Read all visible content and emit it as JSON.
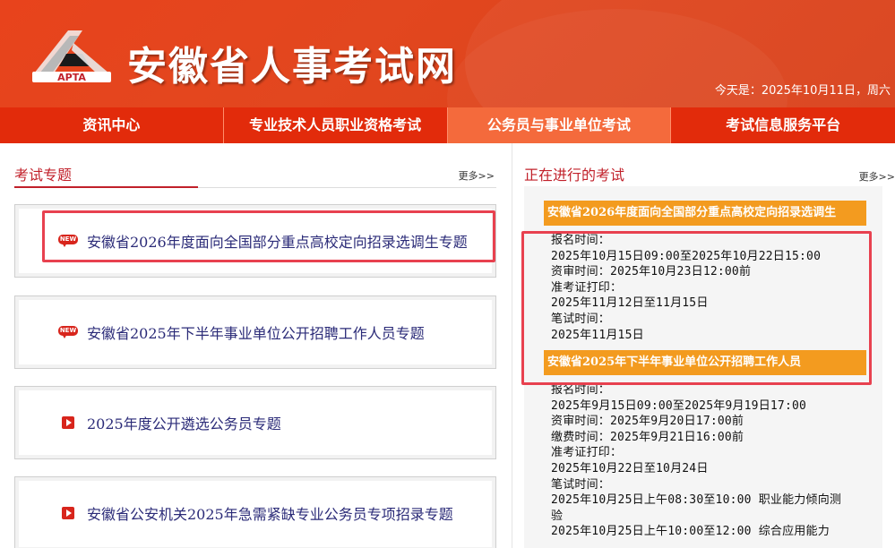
{
  "header": {
    "logo_text": "APTA",
    "site_title": "安徽省人事考试网",
    "date_line": "今天是：2025年10月11日，周六"
  },
  "nav": {
    "items": [
      {
        "label": "资讯中心"
      },
      {
        "label": "专业技术人员职业资格考试"
      },
      {
        "label": "公务员与事业单位考试",
        "active": true
      },
      {
        "label": "考试信息服务平台"
      }
    ]
  },
  "topics": {
    "title": "考试专题",
    "more": "更多>>",
    "items": [
      {
        "label": "安徽省2026年度面向全国部分重点高校定向招录选调生专题",
        "icon": "new-badge-icon",
        "badge_text": "NEW"
      },
      {
        "label": "安徽省2025年下半年事业单位公开招聘工作人员专题",
        "icon": "new-badge-icon",
        "badge_text": "NEW"
      },
      {
        "label": "2025年度公开遴选公务员专题",
        "icon": "play-icon"
      },
      {
        "label": "安徽省公安机关2025年急需紧缺专业公务员专项招录专题",
        "icon": "play-icon"
      }
    ]
  },
  "ongoing": {
    "title": "正在进行的考试",
    "more": "更多>>",
    "exams": [
      {
        "name": "安徽省2026年度面向全国部分重点高校定向招录选调生",
        "lines": [
          "报名时间：",
          "2025年10月15日09:00至2025年10月22日15:00",
          "资审时间：2025年10月23日12:00前",
          "准考证打印：",
          "2025年11月12日至11月15日",
          "笔试时间：",
          "2025年11月15日"
        ]
      },
      {
        "name": "安徽省2025年下半年事业单位公开招聘工作人员",
        "lines": [
          "报名时间：",
          "2025年9月15日09:00至2025年9月19日17:00",
          "资审时间：2025年9月20日17:00前",
          "缴费时间：2025年9月21日16:00前",
          "准考证打印：",
          "2025年10月22日至10月24日",
          "笔试时间：",
          "2025年10月25日上午08:30至10:00 职业能力倾向测",
          "验",
          "2025年10月25日上午10:00至12:00 综合应用能力"
        ]
      }
    ]
  },
  "colors": {
    "header_bg": "#e2471f",
    "nav_bg": "#e22b0b",
    "nav_active": "#f46a3c",
    "section_title": "#c1202a",
    "exam_bar": "#f39b1f",
    "highlight": "#e8414f"
  }
}
